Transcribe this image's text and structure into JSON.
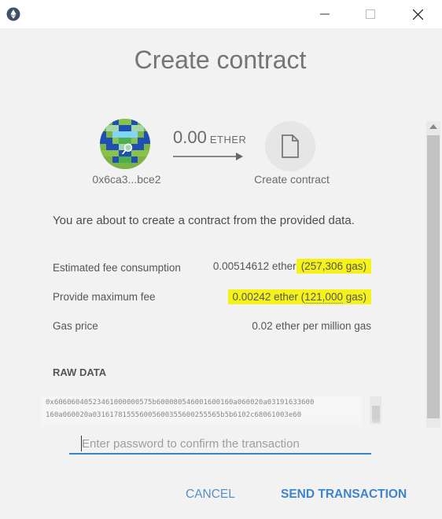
{
  "titlebar": {
    "icons": {
      "app": "ethereum-icon",
      "minimize": "minimize-icon",
      "maximize": "maximize-icon",
      "close": "close-icon"
    }
  },
  "dialog": {
    "title": "Create contract",
    "from": {
      "address": "0x6ca3...bce2"
    },
    "amount": {
      "value": "0.00",
      "unit": "ETHER"
    },
    "to": {
      "label": "Create contract",
      "icon": "document-icon"
    },
    "intro": "You are about to create a contract from the provided data.",
    "fees": [
      {
        "label": "Estimated fee consumption",
        "value_main": "0.00514612 ether",
        "value_paren": "(257,306 gas)"
      },
      {
        "label": "Provide maximum fee",
        "value_main": "0.00242",
        "value_mid": "ether (",
        "value_gas": "121,000",
        "value_end": "gas)"
      },
      {
        "label": "Gas price",
        "value_main": "0.02 ether per million gas"
      }
    ],
    "raw_data": {
      "title": "RAW DATA",
      "lines": [
        "0x60606040523461000000575b600080546001600160a060020a03191633600",
        "160a060020a031617815556005600355600255565b5b6102c68061003e60"
      ]
    },
    "password": {
      "placeholder": "Enter password to confirm the transaction",
      "value": ""
    },
    "buttons": {
      "cancel": "CANCEL",
      "send": "SEND TRANSACTION"
    }
  },
  "colors": {
    "accent": "#3e84cc",
    "highlight": "#f5f21a"
  }
}
